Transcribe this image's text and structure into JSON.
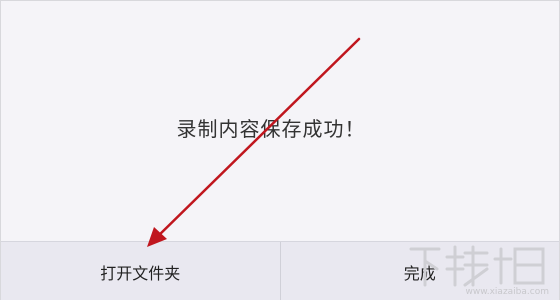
{
  "dialog": {
    "message": "录制内容保存成功！",
    "buttons": {
      "open_folder": "打开文件夹",
      "done": "完成"
    }
  },
  "colors": {
    "background": "#f5f4f8",
    "button_bg": "#e9e8f0",
    "annotation_arrow": "#c0161e"
  },
  "watermark": {
    "brand": "下载吧",
    "url": "www.xiazaiba.com"
  }
}
